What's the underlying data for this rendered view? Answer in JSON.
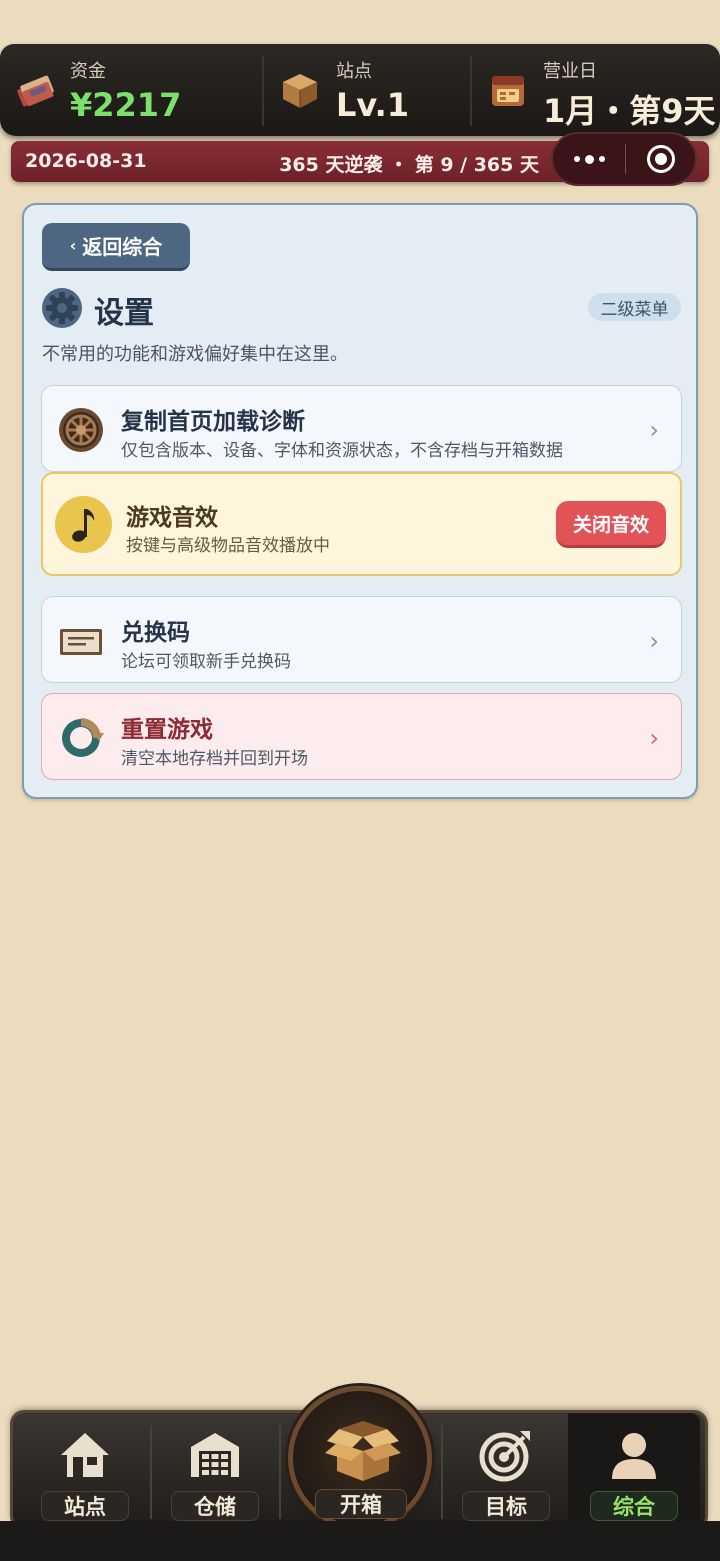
{
  "stats": {
    "funds": {
      "label": "资金",
      "value": "¥2217"
    },
    "site": {
      "label": "站点",
      "value": "Lv.1"
    },
    "day": {
      "label": "营业日",
      "value": "1月・第9天"
    }
  },
  "datestrip": {
    "date": "2026-08-31",
    "progress": "365 天逆袭 ・ 第 9 / 365 天"
  },
  "panel": {
    "back_label": "返回综合",
    "title": "设置",
    "badge": "二级菜单",
    "description": "不常用的功能和游戏偏好集中在这里。",
    "rows": [
      {
        "title": "复制首页加载诊断",
        "subtitle": "仅包含版本、设备、字体和资源状态，不含存档与开箱数据",
        "icon": "wheel-icon"
      },
      {
        "title": "游戏音效",
        "subtitle": "按键与高级物品音效播放中",
        "button": "关闭音效",
        "icon": "music-note-icon"
      },
      {
        "title": "兑换码",
        "subtitle": "论坛可领取新手兑换码",
        "icon": "ticket-icon"
      },
      {
        "title": "重置游戏",
        "subtitle": "清空本地存档并回到开场",
        "icon": "reset-icon"
      }
    ]
  },
  "nav": {
    "station": "站点",
    "storage": "仓储",
    "open": "开箱",
    "goal": "目标",
    "general": "综合",
    "active": "general"
  },
  "colors": {
    "background": "#ebdcbd",
    "funds_green": "#7ee06c",
    "strip_red": "#8a2e36",
    "panel_bg": "#e4ecf4",
    "sound_button": "#e25357",
    "active_tab": "#9be26a"
  }
}
